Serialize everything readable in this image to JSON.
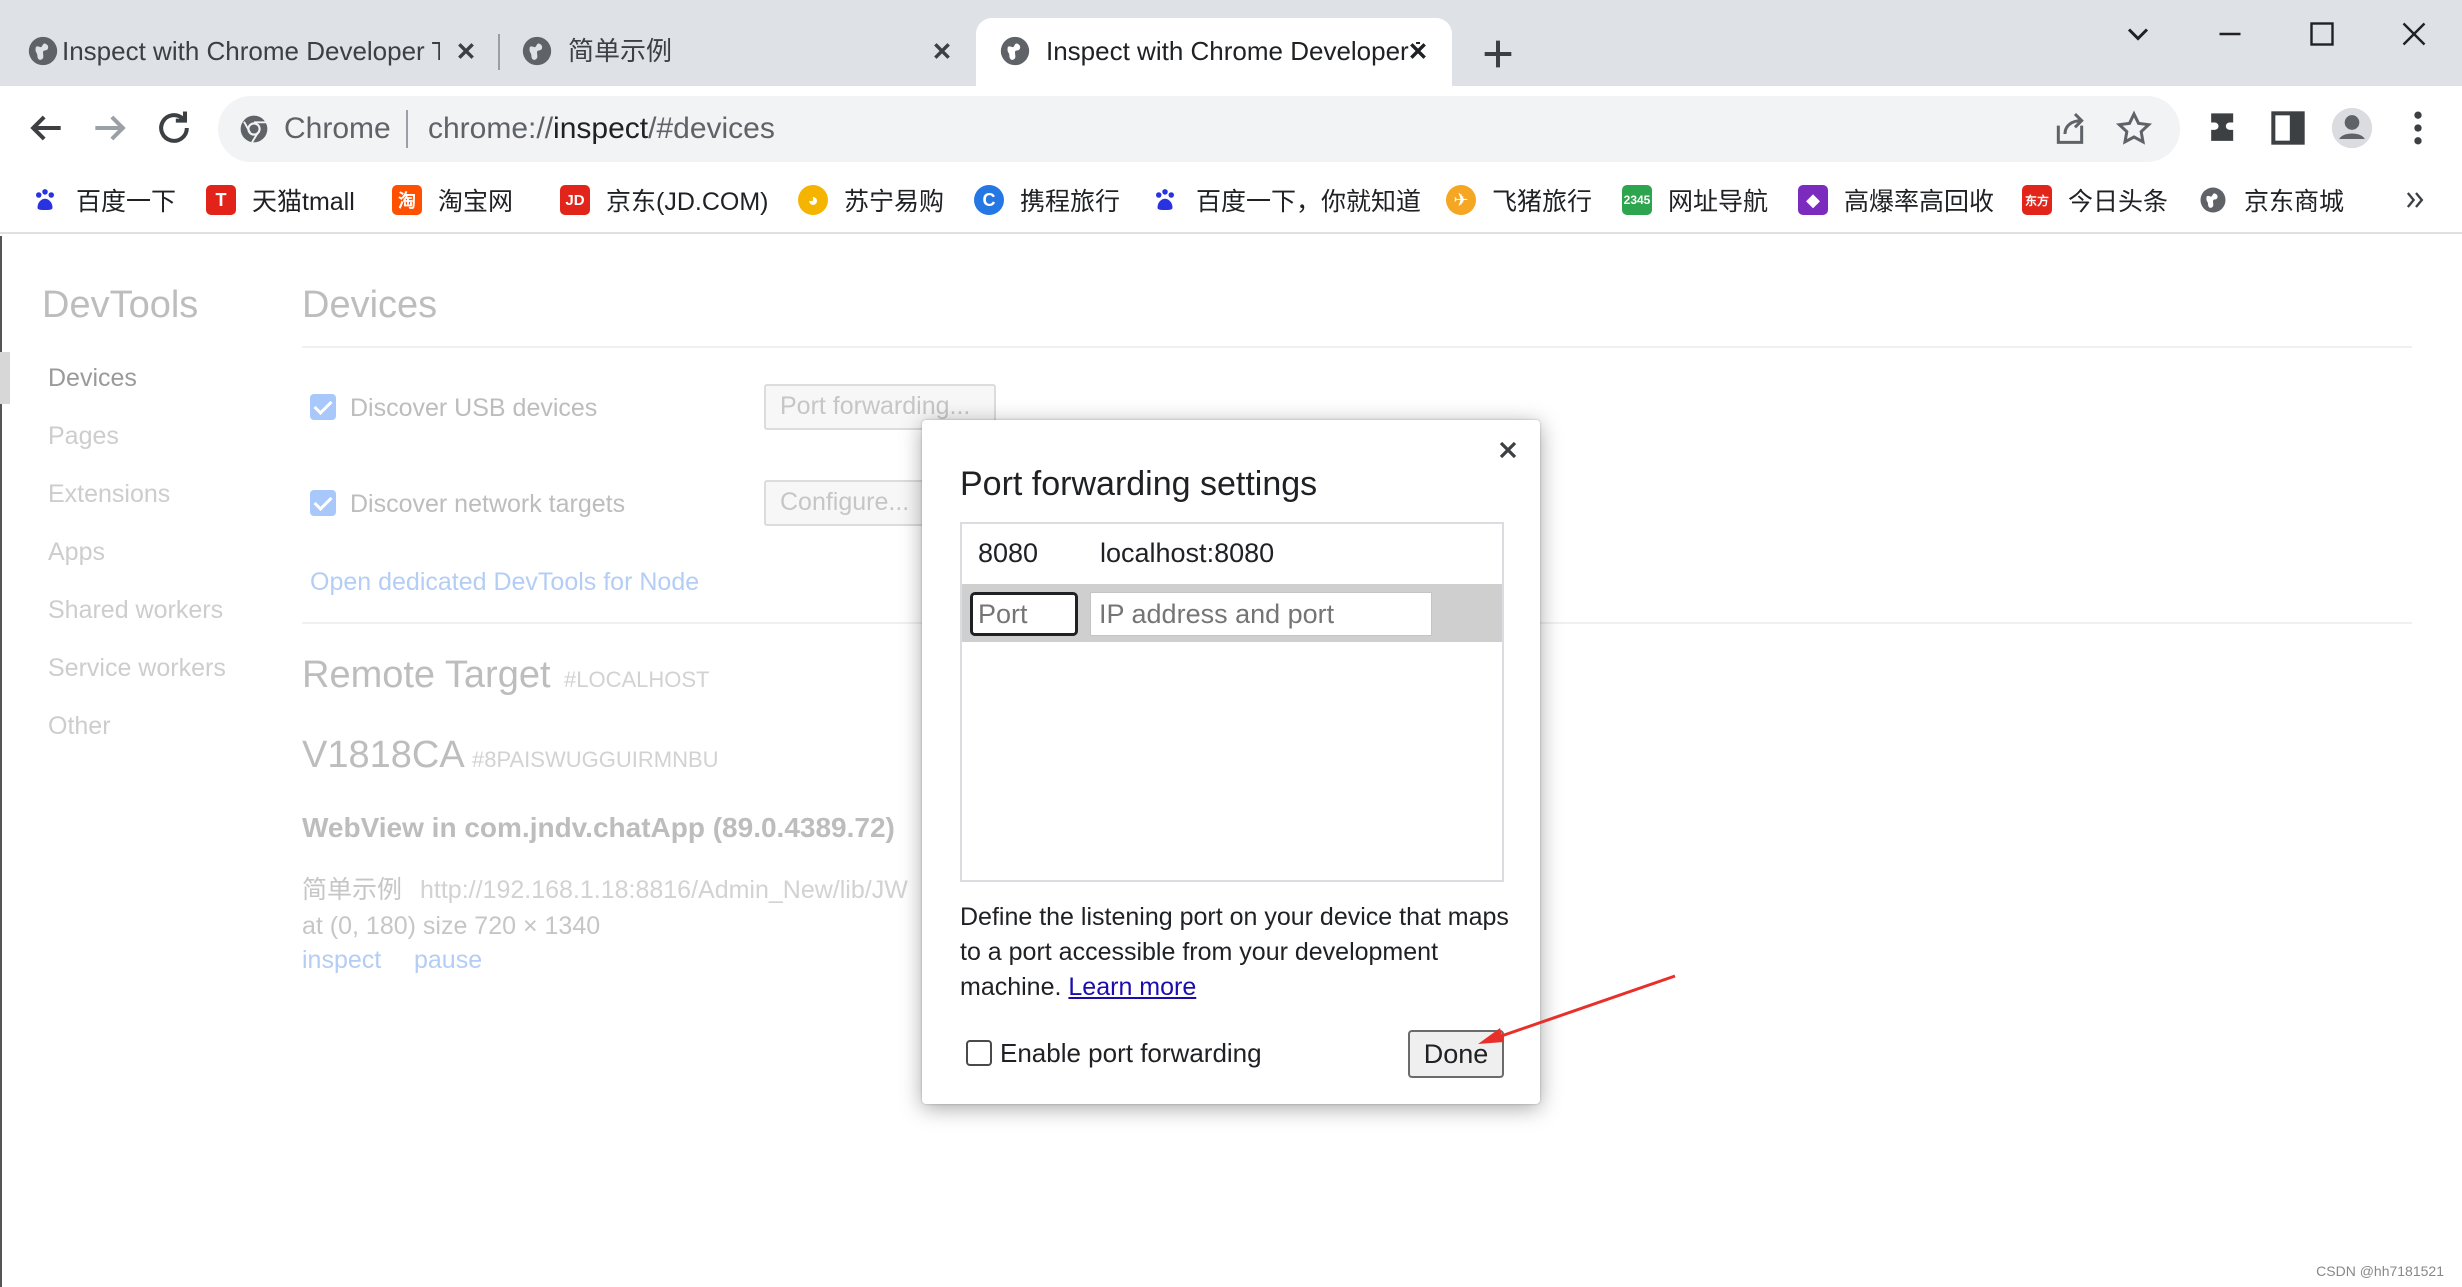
{
  "tabs": [
    {
      "title": "Inspect with Chrome Developer Tools",
      "active": false
    },
    {
      "title": "简单示例",
      "active": false
    },
    {
      "title": "Inspect with Chrome Developer Tools",
      "active": true
    }
  ],
  "address_bar": {
    "site_name": "Chrome",
    "url_scheme": "chrome://",
    "url_host": "inspect",
    "url_path": "/#devices"
  },
  "bookmarks": [
    {
      "label": "百度一下",
      "icon": "baidu-paw-icon",
      "color": "#2932e1"
    },
    {
      "label": "天猫tmall",
      "icon": "tmall-icon",
      "color": "#e2231a"
    },
    {
      "label": "淘宝网",
      "icon": "taobao-icon",
      "color": "#ff5000"
    },
    {
      "label": "京东(JD.COM)",
      "icon": "jd-icon",
      "color": "#e1251b"
    },
    {
      "label": "苏宁易购",
      "icon": "suning-icon",
      "color": "#f4b400"
    },
    {
      "label": "携程旅行",
      "icon": "ctrip-icon",
      "color": "#2577e3"
    },
    {
      "label": "百度一下，你就知道",
      "icon": "baidu-paw-icon",
      "color": "#2932e1"
    },
    {
      "label": "飞猪旅行",
      "icon": "fliggy-icon",
      "color": "#f5a623"
    },
    {
      "label": "网址导航",
      "icon": "2345-icon",
      "color": "#2da44e"
    },
    {
      "label": "高爆率高回收",
      "icon": "game-icon",
      "color": "#7b2cbf"
    },
    {
      "label": "今日头条",
      "icon": "toutiao-icon",
      "color": "#e1251b",
      "icon_text": "东方"
    },
    {
      "label": "京东商城",
      "icon": "globe-icon",
      "color": "#5f6368"
    }
  ],
  "sidebar": {
    "title": "DevTools",
    "items": [
      "Devices",
      "Pages",
      "Extensions",
      "Apps",
      "Shared workers",
      "Service workers",
      "Other"
    ],
    "active": "Devices"
  },
  "devices": {
    "title": "Devices",
    "discover_usb_label": "Discover USB devices",
    "discover_usb_checked": true,
    "port_forwarding_button": "Port forwarding...",
    "discover_network_label": "Discover network targets",
    "discover_network_checked": true,
    "configure_button": "Configure...",
    "node_link": "Open dedicated DevTools for Node"
  },
  "remote_target": {
    "title": "Remote Target",
    "subtitle": "#LOCALHOST",
    "device_name": "V1818CA",
    "device_serial": "#8PAISWUGGUIRMNBU",
    "webview": "WebView in com.jndv.chatApp (89.0.4389.72)",
    "target_name": "简单示例",
    "target_url": "http://192.168.1.18:8816/Admin_New/lib/JW",
    "target_geometry": "at (0, 180)  size 720 × 1340",
    "inspect_link": "inspect",
    "pause_link": "pause"
  },
  "dialog": {
    "title": "Port forwarding settings",
    "rules": [
      {
        "port": "8080",
        "address": "localhost:8080"
      }
    ],
    "port_placeholder": "Port",
    "address_placeholder": "IP address and port",
    "help_text": "Define the listening port on your device that maps to a port accessible from your development machine.",
    "learn_more": "Learn more",
    "enable_label": "Enable port forwarding",
    "enable_checked": false,
    "done_button": "Done"
  },
  "annotation_color": "#e8302a",
  "watermark": "CSDN @hh7181521"
}
